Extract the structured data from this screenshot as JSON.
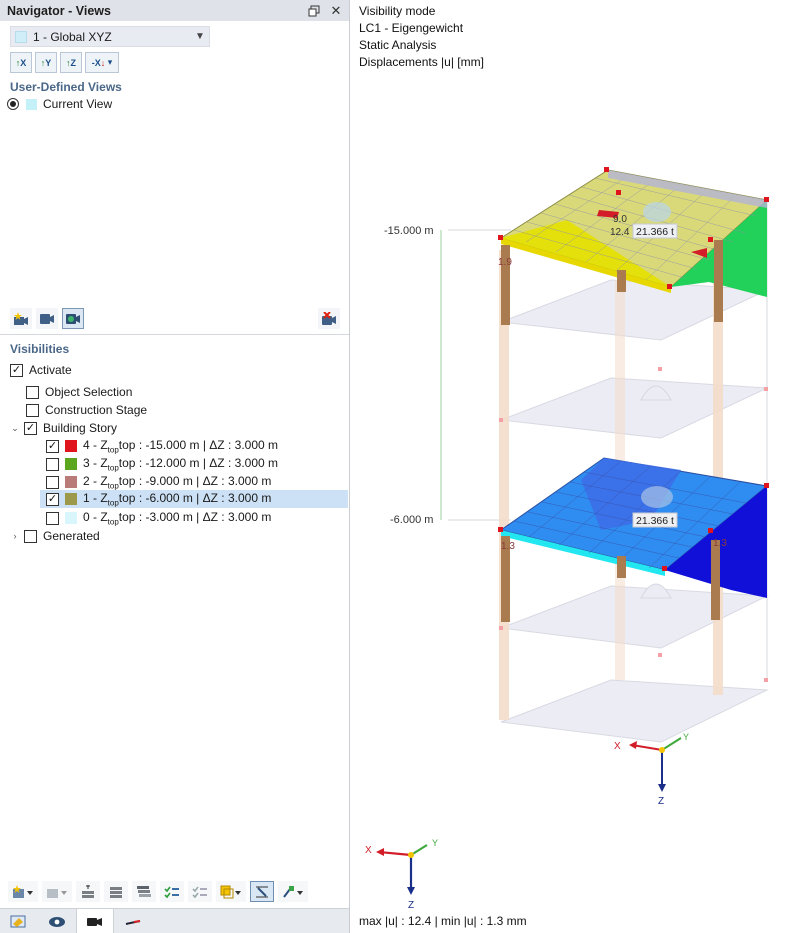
{
  "navigator": {
    "title": "Navigator - Views",
    "view_select": "1 - Global XYZ",
    "axis_buttons": [
      "X",
      "Y",
      "Z",
      "-X"
    ],
    "user_defined_views_title": "User-Defined Views",
    "current_view": "Current View",
    "visibilities_title": "Visibilities",
    "activate": "Activate",
    "object_selection": "Object Selection",
    "construction_stage": "Construction Stage",
    "building_story": "Building Story",
    "generated": "Generated",
    "stories": [
      {
        "label": "4 - Z",
        "rest": "top : -15.000 m | ΔZ : 3.000 m",
        "color": "#e0141c",
        "checked": true
      },
      {
        "label": "3 - Z",
        "rest": "top : -12.000 m | ΔZ : 3.000 m",
        "color": "#5ca61f",
        "checked": false
      },
      {
        "label": "2 - Z",
        "rest": "top : -9.000 m | ΔZ : 3.000 m",
        "color": "#b87b78",
        "checked": false
      },
      {
        "label": "1 - Z",
        "rest": "top : -6.000 m | ΔZ : 3.000 m",
        "color": "#9c9a4a",
        "checked": true
      },
      {
        "label": "0 - Z",
        "rest": "top : -3.000 m | ΔZ : 3.000 m",
        "color": "#d8f6fb",
        "checked": false
      }
    ]
  },
  "viewport": {
    "info": [
      "Visibility mode",
      "LC1 - Eigengewicht",
      "Static Analysis",
      "Displacements |u| [mm]"
    ],
    "level_labels": [
      "-15.000 m",
      "-6.000 m"
    ],
    "values": [
      "9.0",
      "12.4",
      "21.366 t",
      "21.366 t",
      "1.9",
      "1.3",
      "1.3"
    ],
    "axes": {
      "x": "X",
      "y": "Y",
      "z": "Z"
    },
    "status": "max |u| : 12.4 | min |u| : 1.3 mm"
  }
}
